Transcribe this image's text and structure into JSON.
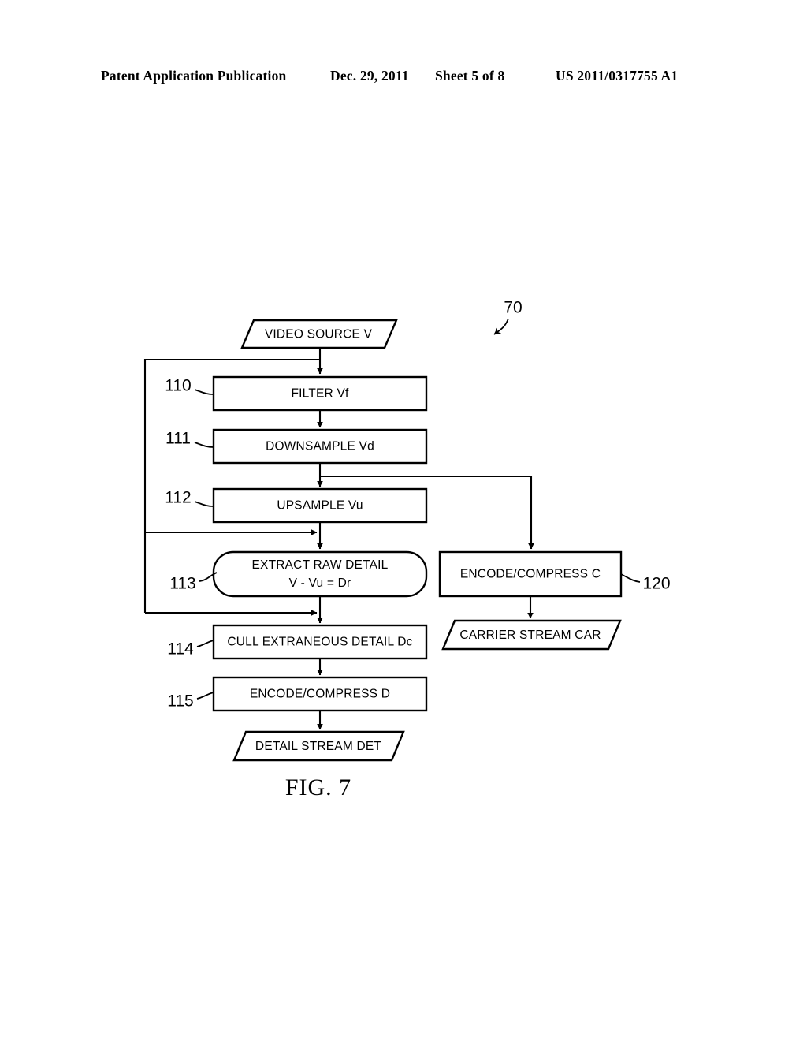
{
  "header": {
    "publication": "Patent Application Publication",
    "date": "Dec. 29, 2011",
    "sheet": "Sheet 5 of 8",
    "document_number": "US 2011/0317755 A1"
  },
  "figure": {
    "caption": "FIG. 7",
    "system_ref": "70",
    "nodes": {
      "video_source": {
        "label": "VIDEO SOURCE V",
        "shape": "parallelogram"
      },
      "filter": {
        "label": "FILTER Vf",
        "ref": "110",
        "shape": "rect"
      },
      "downsample": {
        "label": "DOWNSAMPLE Vd",
        "ref": "111",
        "shape": "rect"
      },
      "upsample": {
        "label": "UPSAMPLE Vu",
        "ref": "112",
        "shape": "rect"
      },
      "extract_raw_detail": {
        "label_line1": "EXTRACT RAW DETAIL",
        "label_line2": "V - Vu = Dr",
        "ref": "113",
        "shape": "rounded-rect"
      },
      "cull_detail": {
        "label": "CULL EXTRANEOUS DETAIL Dc",
        "ref": "114",
        "shape": "rect"
      },
      "encode_d": {
        "label": "ENCODE/COMPRESS D",
        "ref": "115",
        "shape": "rect"
      },
      "detail_stream": {
        "label": "DETAIL STREAM DET",
        "shape": "parallelogram"
      },
      "encode_c": {
        "label": "ENCODE/COMPRESS C",
        "ref": "120",
        "shape": "rect"
      },
      "carrier_stream": {
        "label": "CARRIER STREAM CAR",
        "shape": "parallelogram"
      }
    }
  },
  "chart_data": {
    "type": "diagram",
    "title": "FIG. 7",
    "diagram_kind": "flowchart",
    "nodes": [
      {
        "id": "video_source",
        "label": "VIDEO SOURCE V",
        "shape": "parallelogram",
        "ref": null
      },
      {
        "id": "filter",
        "label": "FILTER Vf",
        "shape": "rect",
        "ref": "110"
      },
      {
        "id": "downsample",
        "label": "DOWNSAMPLE Vd",
        "shape": "rect",
        "ref": "111"
      },
      {
        "id": "upsample",
        "label": "UPSAMPLE Vu",
        "shape": "rect",
        "ref": "112"
      },
      {
        "id": "extract_raw_detail",
        "label": "EXTRACT RAW DETAIL / V - Vu = Dr",
        "shape": "rounded-rect",
        "ref": "113"
      },
      {
        "id": "cull_detail",
        "label": "CULL EXTRANEOUS DETAIL Dc",
        "shape": "rect",
        "ref": "114"
      },
      {
        "id": "encode_d",
        "label": "ENCODE/COMPRESS D",
        "shape": "rect",
        "ref": "115"
      },
      {
        "id": "detail_stream",
        "label": "DETAIL STREAM DET",
        "shape": "parallelogram",
        "ref": null
      },
      {
        "id": "encode_c",
        "label": "ENCODE/COMPRESS C",
        "shape": "rect",
        "ref": "120"
      },
      {
        "id": "carrier_stream",
        "label": "CARRIER STREAM CAR",
        "shape": "parallelogram",
        "ref": null
      }
    ],
    "edges": [
      {
        "from": "video_source",
        "to": "filter"
      },
      {
        "from": "filter",
        "to": "downsample"
      },
      {
        "from": "downsample",
        "to": "upsample"
      },
      {
        "from": "downsample",
        "to": "encode_c"
      },
      {
        "from": "upsample",
        "to": "extract_raw_detail"
      },
      {
        "from": "video_source",
        "to": "extract_raw_detail"
      },
      {
        "from": "video_source",
        "to": "cull_detail"
      },
      {
        "from": "extract_raw_detail",
        "to": "cull_detail"
      },
      {
        "from": "cull_detail",
        "to": "encode_d"
      },
      {
        "from": "encode_d",
        "to": "detail_stream"
      },
      {
        "from": "encode_c",
        "to": "carrier_stream"
      }
    ]
  }
}
